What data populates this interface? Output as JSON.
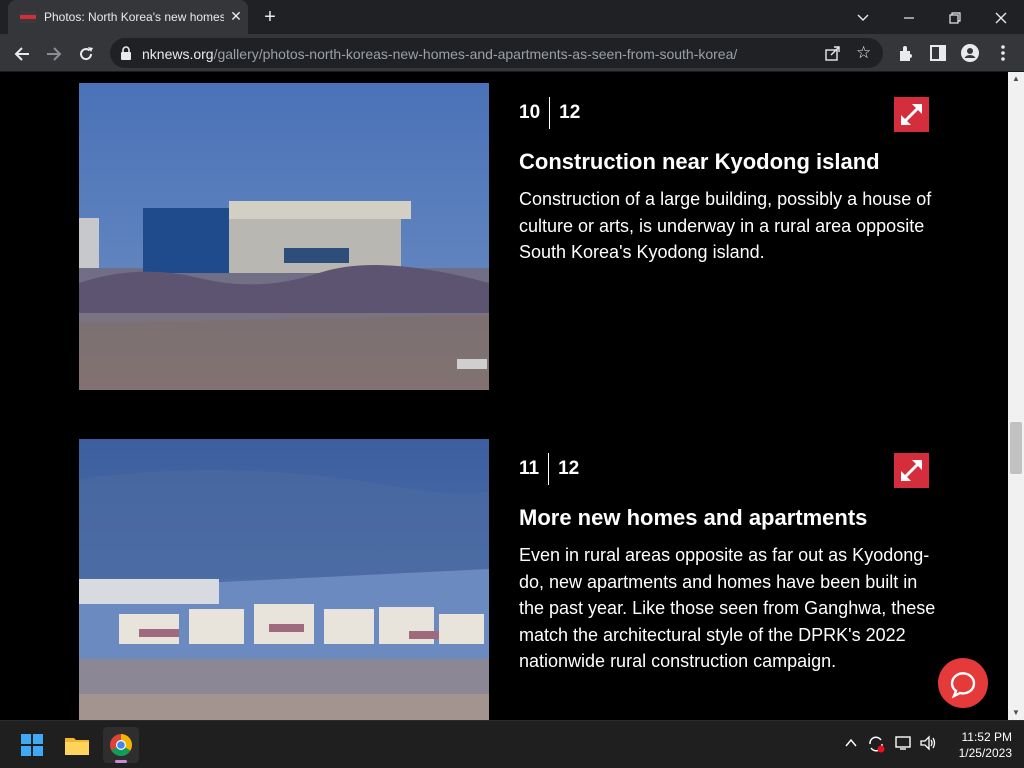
{
  "browser": {
    "tab_title": "Photos: North Korea's new homes and apartments",
    "tab_close": "✕",
    "new_tab": "+",
    "url_host": "nknews.org",
    "url_path": "/gallery/photos-north-koreas-new-homes-and-apartments-as-seen-from-south-korea/"
  },
  "slides": [
    {
      "index": "10",
      "total": "12",
      "title": "Construction near Kyodong island",
      "description": "Construction of a large building, possibly a house of culture or arts, is underway in a rural area opposite South Korea's Kyodong island."
    },
    {
      "index": "11",
      "total": "12",
      "title": "More new homes and apartments",
      "description": "Even in rural areas opposite as far out as Kyodong-do, new apartments and homes have been built in the past year. Like those seen from Ganghwa, these match the architectural style of the DPRK's 2022 nationwide rural construction campaign."
    }
  ],
  "taskbar": {
    "time": "11:52 PM",
    "date": "1/25/2023"
  },
  "colors": {
    "accent_red": "#d42e3c",
    "chat_red": "#e43a3a",
    "page_bg": "#000000"
  },
  "icons": [
    "favicon-icon",
    "back-icon",
    "forward-icon",
    "reload-icon",
    "lock-icon",
    "share-icon",
    "star-icon",
    "extensions-icon",
    "side-panel-icon",
    "profile-icon",
    "menu-icon",
    "expand-icon",
    "chat-icon",
    "windows-start-icon",
    "file-explorer-icon",
    "chrome-icon"
  ]
}
